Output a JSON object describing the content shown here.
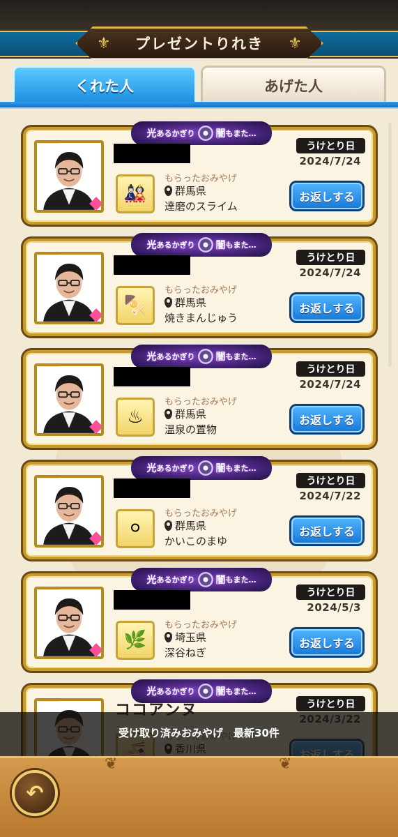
{
  "header": {
    "title": "プレゼントりれき"
  },
  "tabs": [
    {
      "label": "くれた人",
      "active": true
    },
    {
      "label": "あげた人",
      "active": false
    }
  ],
  "card_common": {
    "banner_text_1": "光",
    "banner_text_2": "あるかぎり",
    "banner_text_3": "闇",
    "banner_text_4": "もまた…",
    "received_label": "うけとり日",
    "souvenir_label": "もらったおみやげ",
    "return_button": "お返しする"
  },
  "cards": [
    {
      "name": "",
      "date": "2024/7/24",
      "prefecture": "群馬県",
      "item": "達磨のスライム",
      "icon": "daruma-slime-icon"
    },
    {
      "name": "",
      "date": "2024/7/24",
      "prefecture": "群馬県",
      "item": "焼きまんじゅう",
      "icon": "yaki-manju-icon"
    },
    {
      "name": "",
      "date": "2024/7/24",
      "prefecture": "群馬県",
      "item": "温泉の置物",
      "icon": "onsen-ornament-icon"
    },
    {
      "name": "",
      "date": "2024/7/22",
      "prefecture": "群馬県",
      "item": "かいこのまゆ",
      "icon": "silkworm-cocoon-icon"
    },
    {
      "name": "",
      "date": "2024/5/3",
      "prefecture": "埼玉県",
      "item": "深谷ねぎ",
      "icon": "fukaya-negi-icon"
    },
    {
      "name": "ココアンヌ",
      "date": "2024/3/22",
      "prefecture": "香川県",
      "item": "",
      "icon": "udon-icon"
    }
  ],
  "notice": "受け取り済みおみやげ　最新30件",
  "footer": {
    "back_icon": "back-arrow-icon"
  }
}
